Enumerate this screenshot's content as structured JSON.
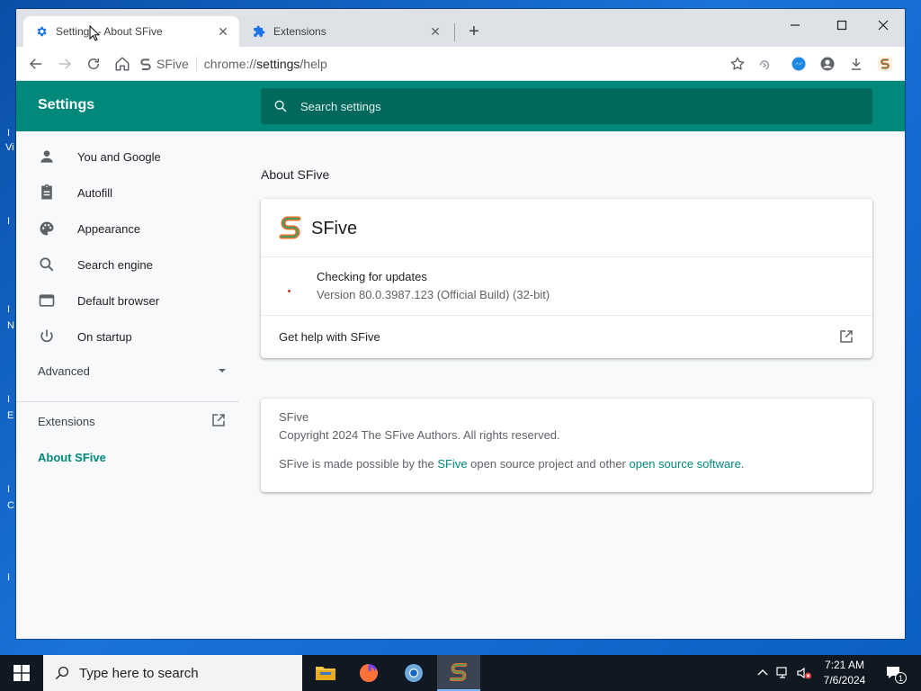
{
  "desktop": {
    "edge_marks": [
      "I",
      "Vi",
      "I",
      "I",
      "N",
      "I",
      "E",
      "I",
      "C",
      "I"
    ]
  },
  "browser": {
    "tabs": [
      {
        "title": "Settings - About SFive",
        "icon": "gear-icon",
        "active": true
      },
      {
        "title": "Extensions",
        "icon": "puzzle-icon",
        "active": false
      }
    ],
    "new_tab_label": "+",
    "omnibox": {
      "site": "SFive",
      "url_prefix": "chrome://",
      "url_host": "settings",
      "url_path": "/help"
    }
  },
  "settings": {
    "title": "Settings",
    "search_placeholder": "Search settings",
    "nav": [
      {
        "label": "You and Google",
        "icon": "person-icon"
      },
      {
        "label": "Autofill",
        "icon": "clipboard-icon"
      },
      {
        "label": "Appearance",
        "icon": "palette-icon"
      },
      {
        "label": "Search engine",
        "icon": "search-icon"
      },
      {
        "label": "Default browser",
        "icon": "browser-window-icon"
      },
      {
        "label": "On startup",
        "icon": "power-icon"
      }
    ],
    "advanced_label": "Advanced",
    "extensions_label": "Extensions",
    "about_label": "About SFive",
    "accent_color": "#00897b"
  },
  "about": {
    "section_title": "About SFive",
    "product_name": "SFive",
    "update_status": "Checking for updates",
    "version": "Version 80.0.3987.123 (Official Build) (32-bit)",
    "help_label": "Get help with SFive",
    "info_name": "SFive",
    "copyright": "Copyright 2024 The SFive Authors. All rights reserved.",
    "credits": {
      "prefix": "SFive is made possible by the ",
      "link1": "SFive",
      "middle": " open source project and other ",
      "link2": "open source software",
      "suffix": "."
    }
  },
  "taskbar": {
    "search_placeholder": "Type here to search",
    "time": "7:21 AM",
    "date": "7/6/2024",
    "notification_count": "1"
  }
}
